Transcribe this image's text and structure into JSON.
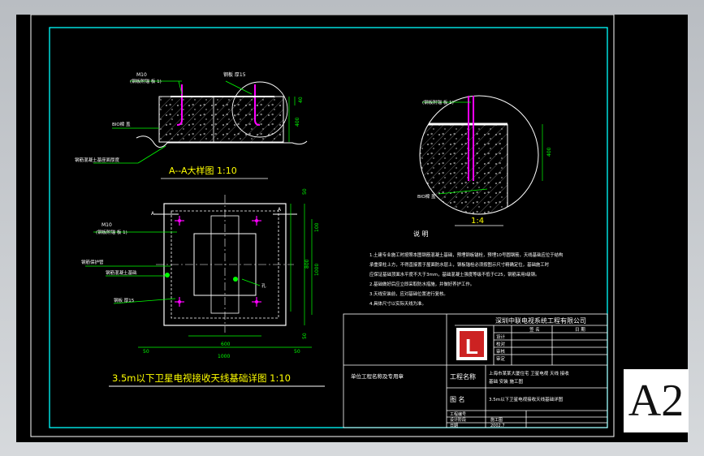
{
  "colors": {
    "background": "#000000",
    "frame": "#c9ccd0",
    "line_white": "#ffffff",
    "line_green": "#00ff00",
    "line_cyan": "#00ffff",
    "line_magenta": "#ff00ff",
    "line_yellow": "#ffff00",
    "text_gray": "#d8d8d8"
  },
  "section_detail": {
    "title": "A--A大样图 1:10",
    "label_m10": "M10",
    "label_plate": "钢板 厚15",
    "label_plate_top": "(钢板附锚 板 1)",
    "label_paint": "BIO樑 盖",
    "label_concrete": "钢筋混凝土基座面厚度",
    "dim_1": "40",
    "dim_2": "400"
  },
  "zoom_detail": {
    "title": "1:4",
    "label_top": "(钢板附锚 板 1)",
    "label_bottom": "BIO樑 盖",
    "dim_1": "400"
  },
  "plan_view": {
    "title": "3.5m以下卫星电视接收天线基础详图 1:10",
    "marker_a_top": "A",
    "marker_a_bottom": "A",
    "label_m10": "M10",
    "label_m10b": "(钢板附锚 板 1)",
    "label_drain": "钢筋混凝土基础",
    "label_pipe": "钢筋保护管",
    "label_plate": "钢板 厚15",
    "label_hole": "孔",
    "dim_inner": "600",
    "dim_outer": "1000",
    "dim_right": "800",
    "dim_side": "100",
    "dim_50a": "50",
    "dim_50b": "50",
    "dim_50c": "50",
    "dim_50d": "50"
  },
  "notes": {
    "heading": "说 明",
    "lines": [
      "1.土建专业施工时按照本图钢筋混凝土基础，预埋钢板锚栓，预埋10号圆钢筋，天线基础应位于结构",
      "承重梁柱上方，不得直接置于屋面防水层上，钢板锚栓必须按图示尺寸精确定位，基础施工时",
      "应保证基础顶面水平度不大于3mm，基础混凝土强度等级不低于C25，钢筋采用I级钢。",
      "2.基础做好后应立即采取防水措施，并做好养护工作。",
      "3.天线安装前，应对基础位置进行复核。",
      "4.具体尺寸以实际天线为准。"
    ]
  },
  "title_block": {
    "company": "深圳中联电视系统工程有限公司",
    "label_project": "工程名称",
    "project_name": "上海市某某大厦住宅 卫星电视 天线 接收",
    "project_name2": "基础 安装 施工图",
    "label_drawing": "图   名",
    "drawing_name": "3.5m以下卫星电视接收天线基础详图",
    "left_label": "单位工程名称及专用章",
    "rows": [
      "设计",
      "校对",
      "审核",
      "审定"
    ],
    "row_labels_bottom": [
      "工程编号",
      "设计阶段",
      "日期"
    ],
    "row_values_bottom": [
      "",
      "施工图",
      "2002.7"
    ],
    "col_sign": "签 名",
    "col_date": "日 期",
    "logo": "L"
  },
  "sheet_size": "A2"
}
